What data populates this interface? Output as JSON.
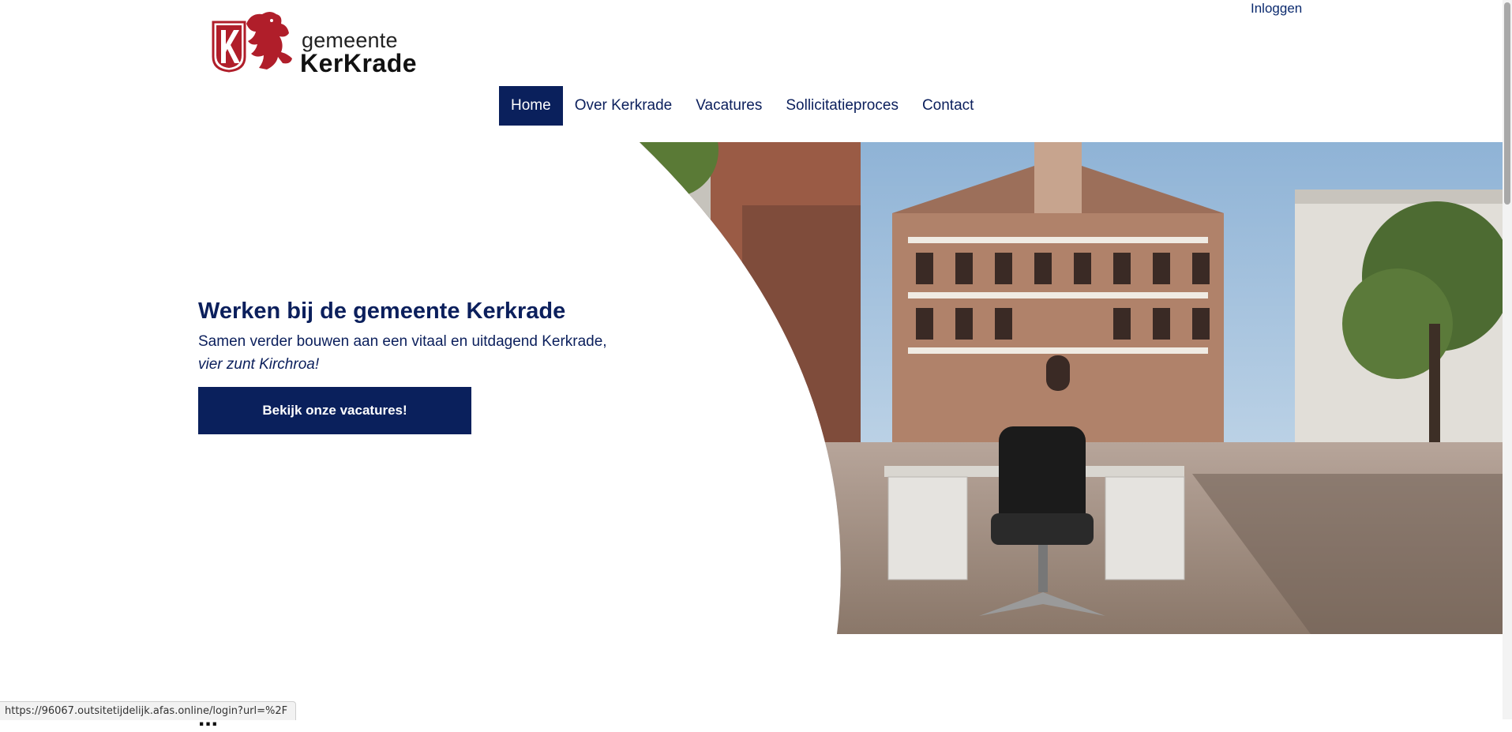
{
  "header": {
    "login_label": "Inloggen",
    "logo": {
      "line1": "gemeente",
      "line2": "KerKrade",
      "icon": "kerkrade-lion-crest-icon"
    }
  },
  "nav": {
    "items": [
      {
        "label": "Home",
        "active": true
      },
      {
        "label": "Over Kerkrade",
        "active": false
      },
      {
        "label": "Vacatures",
        "active": false
      },
      {
        "label": "Sollicitatieproces",
        "active": false
      },
      {
        "label": "Contact",
        "active": false
      }
    ]
  },
  "hero": {
    "title": "Werken bij de gemeente Kerkrade",
    "subtitle": "Samen verder bouwen aan een vitaal en uitdagend Kerkrade,",
    "subtitle_italic": "vier zunt Kirchroa!",
    "cta_label": "Bekijk onze vacatures!",
    "image": "town-hall-with-desk-and-chair-photo"
  },
  "below_fold": {
    "heading_partial": "..."
  },
  "status_bar": {
    "url": "https://96067.outsitetijdelijk.afas.online/login?url=%2F"
  },
  "colors": {
    "brand_navy": "#0a205c",
    "brand_red": "#b01e2a",
    "background": "#ffffff"
  }
}
